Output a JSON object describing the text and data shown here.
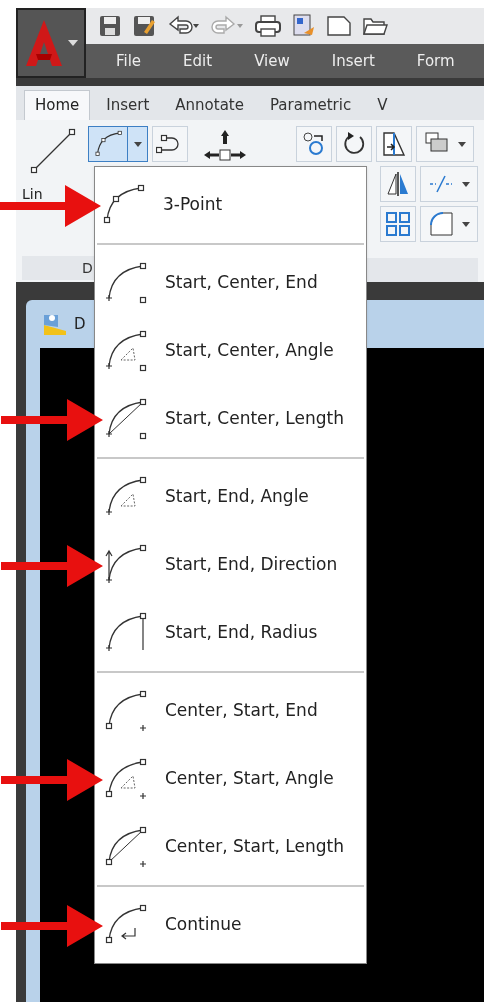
{
  "menu_bar": [
    "File",
    "Edit",
    "View",
    "Insert",
    "Form"
  ],
  "ribbon_tabs": [
    {
      "label": "Home",
      "selected": true
    },
    {
      "label": "Insert",
      "selected": false
    },
    {
      "label": "Annotate",
      "selected": false
    },
    {
      "label": "Parametric",
      "selected": false
    },
    {
      "label": "V",
      "selected": false
    }
  ],
  "draw_panel": {
    "line_label": "Lin",
    "title": "D",
    "arc_expanded": true
  },
  "document": {
    "title": "D"
  },
  "arc_menu": {
    "groups": [
      [
        {
          "label": "3-Point",
          "pointer": true
        }
      ],
      [
        {
          "label": "Start, Center, End",
          "pointer": false
        },
        {
          "label": "Start, Center, Angle",
          "pointer": false
        },
        {
          "label": "Start, Center, Length",
          "pointer": true
        }
      ],
      [
        {
          "label": "Start, End, Angle",
          "pointer": false
        },
        {
          "label": "Start, End, Direction",
          "pointer": true
        },
        {
          "label": "Start, End, Radius",
          "pointer": false
        }
      ],
      [
        {
          "label": "Center, Start, End",
          "pointer": false
        },
        {
          "label": "Center, Start, Angle",
          "pointer": true
        },
        {
          "label": "Center, Start, Length",
          "pointer": false
        }
      ],
      [
        {
          "label": "Continue",
          "pointer": true
        }
      ]
    ]
  }
}
